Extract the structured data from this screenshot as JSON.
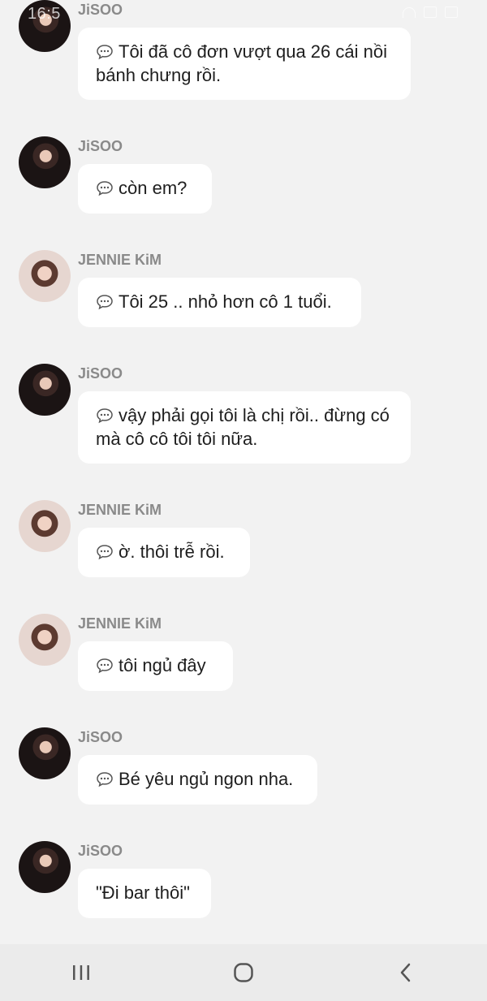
{
  "status_bar": {
    "time": "16:5"
  },
  "messages": [
    {
      "sender": "JiSOO",
      "avatar": "jisoo-avatar",
      "text": "Tôi đã cô đơn vượt qua 26 cái nồi bánh chưng rồi.",
      "icon": "chat-bubble-icon"
    },
    {
      "sender": "JiSOO",
      "avatar": "jisoo-avatar",
      "text": "còn em?",
      "icon": "chat-bubble-icon"
    },
    {
      "sender": "JENNIE KiM",
      "avatar": "jennie-avatar",
      "text": "Tôi 25 .. nhỏ hơn cô 1 tuổi.",
      "icon": "chat-bubble-icon"
    },
    {
      "sender": "JiSOO",
      "avatar": "jisoo-avatar",
      "text": "vậy phải gọi tôi là chị rồi.. đừng có mà cô cô tôi tôi nữa.",
      "icon": "chat-bubble-icon"
    },
    {
      "sender": "JENNIE KiM",
      "avatar": "jennie-avatar",
      "text": "ờ. thôi trễ rồi.",
      "icon": "chat-bubble-icon"
    },
    {
      "sender": "JENNIE KiM",
      "avatar": "jennie-avatar",
      "text": "tôi ngủ đây",
      "icon": "chat-bubble-icon"
    },
    {
      "sender": "JiSOO",
      "avatar": "jisoo-avatar",
      "text": "Bé yêu ngủ ngon nha.",
      "icon": "chat-bubble-icon"
    },
    {
      "sender": "JiSOO",
      "avatar": "jisoo-avatar",
      "text": "\"Đi bar thôi\"",
      "icon": null
    }
  ],
  "nav_bar": {
    "items": [
      "recent-apps-icon",
      "home-icon",
      "back-icon"
    ]
  },
  "colors": {
    "background": "#f2f2f2",
    "bubble": "#ffffff",
    "sender": "#8a8a8a",
    "text": "#1e1e1e",
    "nav_bar": "#ebebeb"
  }
}
